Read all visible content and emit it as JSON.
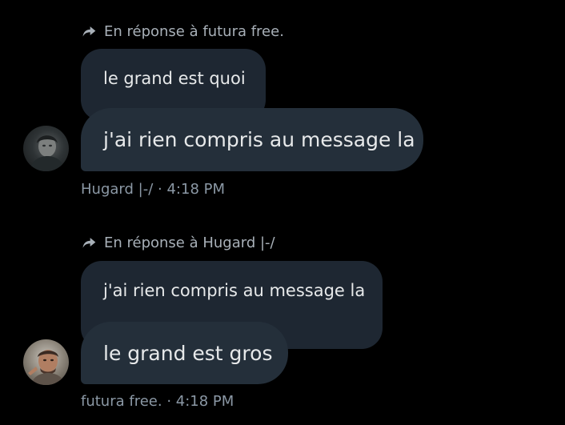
{
  "messages": [
    {
      "reply_to_text": "En réponse à futura free.",
      "quoted_text": "le grand est quoi",
      "message_text": "j'ai rien compris au message la",
      "author": "Hugard |-/",
      "separator": "·",
      "time": "4:18 PM",
      "avatar_icon": "avatar-photo"
    },
    {
      "reply_to_text": "En réponse à Hugard |-/",
      "quoted_text": "j'ai rien compris au message la",
      "message_text": "le grand est gros",
      "author": "futura free.",
      "separator": "·",
      "time": "4:18 PM",
      "avatar_icon": "avatar-photo"
    }
  ],
  "colors": {
    "background": "#000000",
    "bubble_main": "#242f3a",
    "bubble_quoted": "#1e2732",
    "text_primary": "#e7e9ea",
    "text_secondary": "#8b98a5"
  }
}
